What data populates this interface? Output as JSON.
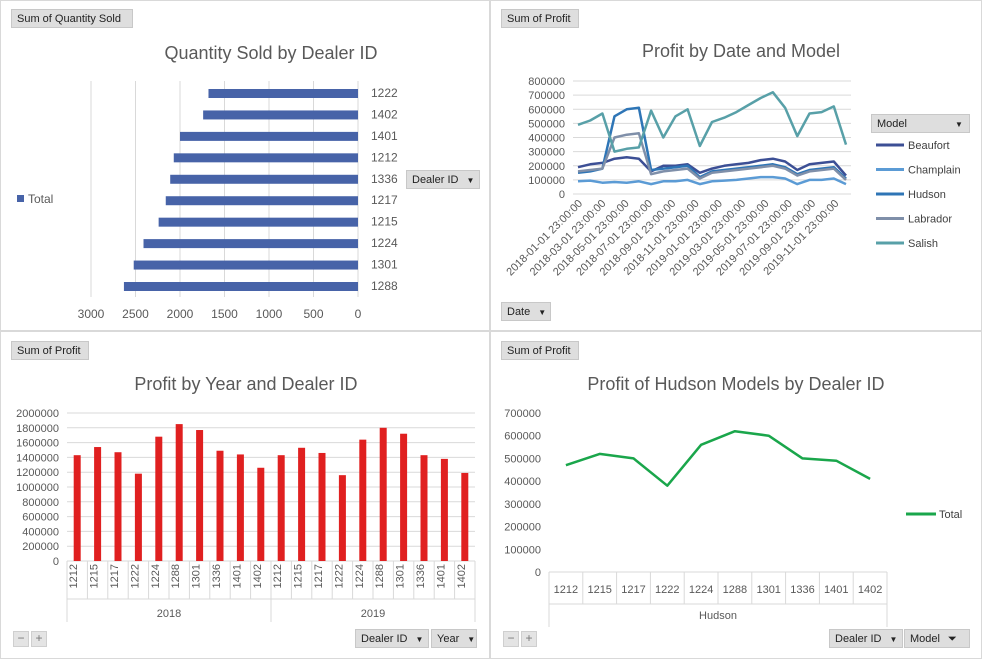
{
  "chart1": {
    "field_button": "Sum of Quantity Sold",
    "axis_button": "Dealer ID",
    "legend": "Total",
    "chart_data": {
      "type": "bar",
      "orientation": "horizontal",
      "title": "Quantity Sold by Dealer ID",
      "categories": [
        "1288",
        "1301",
        "1224",
        "1215",
        "1217",
        "1336",
        "1212",
        "1401",
        "1402",
        "1222"
      ],
      "values": [
        2630,
        2520,
        2410,
        2240,
        2160,
        2110,
        2070,
        2000,
        1740,
        1680
      ],
      "xlim": [
        0,
        3000
      ],
      "xticks": [
        "3000",
        "2500",
        "2000",
        "1500",
        "1000",
        "500",
        "0"
      ],
      "x_reversed": true,
      "color": "#4763a8",
      "grid": true,
      "legend_position": "left"
    }
  },
  "chart2": {
    "field_button": "Sum of Profit",
    "axis_button": "Date",
    "legend_title": "Model",
    "chart_data": {
      "type": "line",
      "title": "Profit by Date and Model",
      "xlabels": [
        "2018-01-01 23:00:00",
        "2018-03-01 23:00:00",
        "2018-05-01 23:00:00",
        "2018-07-01 23:00:00",
        "2018-09-01 23:00:00",
        "2018-11-01 23:00:00",
        "2019-01-01 23:00:00",
        "2019-03-01 23:00:00",
        "2019-05-01 23:00:00",
        "2019-07-01 23:00:00",
        "2019-09-01 23:00:00",
        "2019-11-01 23:00:00"
      ],
      "ylim": [
        0,
        800000
      ],
      "yticks": [
        "800000",
        "700000",
        "600000",
        "500000",
        "400000",
        "300000",
        "200000",
        "100000",
        "0"
      ],
      "series": [
        {
          "name": "Beaufort",
          "color": "#3c4f95",
          "values": [
            190000,
            210000,
            220000,
            250000,
            260000,
            250000,
            160000,
            200000,
            200000,
            210000,
            150000,
            180000,
            200000,
            210000,
            220000,
            240000,
            250000,
            230000,
            170000,
            210000,
            220000,
            230000,
            130000
          ]
        },
        {
          "name": "Champlain",
          "color": "#5b9bd5",
          "values": [
            90000,
            95000,
            80000,
            85000,
            80000,
            90000,
            70000,
            90000,
            90000,
            100000,
            70000,
            90000,
            95000,
            100000,
            110000,
            120000,
            120000,
            110000,
            70000,
            100000,
            100000,
            110000,
            70000
          ]
        },
        {
          "name": "Hudson",
          "color": "#2e75b6",
          "values": [
            150000,
            160000,
            180000,
            550000,
            600000,
            610000,
            170000,
            180000,
            190000,
            200000,
            120000,
            160000,
            170000,
            180000,
            190000,
            200000,
            210000,
            190000,
            140000,
            170000,
            180000,
            190000,
            110000
          ]
        },
        {
          "name": "Labrador",
          "color": "#7f8fa9",
          "values": [
            160000,
            170000,
            180000,
            400000,
            420000,
            430000,
            140000,
            160000,
            170000,
            180000,
            110000,
            150000,
            160000,
            170000,
            180000,
            190000,
            200000,
            180000,
            130000,
            160000,
            170000,
            180000,
            100000
          ]
        },
        {
          "name": "Salish",
          "color": "#58a0a8",
          "values": [
            490000,
            520000,
            570000,
            300000,
            320000,
            330000,
            590000,
            400000,
            550000,
            600000,
            340000,
            510000,
            540000,
            580000,
            630000,
            680000,
            720000,
            610000,
            410000,
            570000,
            580000,
            620000,
            350000
          ]
        }
      ],
      "grid": true,
      "legend_position": "right"
    }
  },
  "chart3": {
    "field_button": "Sum of Profit",
    "buttons": [
      "Dealer ID",
      "Year"
    ],
    "zoom": [
      "−",
      "+"
    ],
    "chart_data": {
      "type": "bar",
      "title": "Profit by Year and Dealer ID",
      "groups": [
        {
          "year": "2018",
          "categories": [
            "1212",
            "1215",
            "1217",
            "1222",
            "1224",
            "1288",
            "1301",
            "1336",
            "1401",
            "1402"
          ],
          "values": [
            1430000,
            1540000,
            1470000,
            1180000,
            1680000,
            1850000,
            1770000,
            1490000,
            1440000,
            1260000
          ]
        },
        {
          "year": "2019",
          "categories": [
            "1212",
            "1215",
            "1217",
            "1222",
            "1224",
            "1288",
            "1301",
            "1336",
            "1401",
            "1402"
          ],
          "values": [
            1430000,
            1530000,
            1460000,
            1160000,
            1640000,
            1800000,
            1720000,
            1430000,
            1380000,
            1190000
          ]
        }
      ],
      "ylim": [
        0,
        2000000
      ],
      "yticks": [
        "2000000",
        "1800000",
        "1600000",
        "1400000",
        "1200000",
        "1000000",
        "800000",
        "600000",
        "400000",
        "200000",
        "0"
      ],
      "color": "#e02020",
      "grid": true
    }
  },
  "chart4": {
    "field_button": "Sum of Profit",
    "buttons": [
      "Dealer ID",
      "Model"
    ],
    "zoom": [
      "−",
      "+"
    ],
    "legend": "Total",
    "chart_data": {
      "type": "line",
      "title": "Profit of Hudson Models by Dealer ID",
      "group": "Hudson",
      "categories": [
        "1212",
        "1215",
        "1217",
        "1222",
        "1224",
        "1288",
        "1301",
        "1336",
        "1401",
        "1402"
      ],
      "values": [
        470000,
        520000,
        500000,
        380000,
        560000,
        620000,
        600000,
        500000,
        490000,
        410000
      ],
      "ylim": [
        0,
        700000
      ],
      "yticks": [
        "700000",
        "600000",
        "500000",
        "400000",
        "300000",
        "200000",
        "100000",
        "0"
      ],
      "color": "#1aa64b",
      "grid": false,
      "legend_position": "right"
    }
  }
}
